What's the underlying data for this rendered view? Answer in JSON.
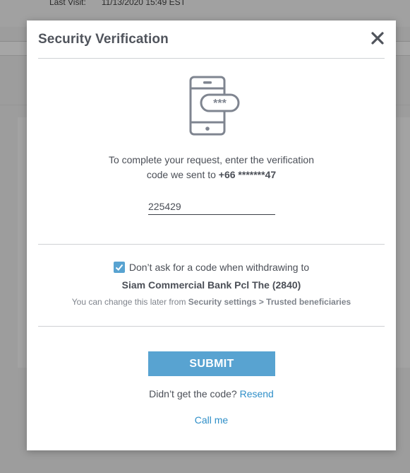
{
  "background": {
    "last_visit_label": "Last Visit:",
    "last_visit_value": "11/13/2020 15:49 EST"
  },
  "modal": {
    "title": "Security Verification",
    "close_icon": "close-icon",
    "phone_icon": "phone-password-icon",
    "phone_icon_text": "***",
    "instruction_line1": "To complete your request, enter the verification",
    "instruction_line2_prefix": "code we sent to",
    "phone_masked": "+66 *******47",
    "code_value": "225429",
    "remember": {
      "checked": true,
      "label": "Don’t ask for a code when withdrawing to",
      "bank": "Siam Commercial Bank Pcl The (2840)",
      "note_prefix": "You can change this later from",
      "note_link": "Security settings > Trusted beneficiaries"
    },
    "submit_label": "SUBMIT",
    "resend_prefix": "Didn’t get the code?",
    "resend_link": "Resend",
    "call_me": "Call me"
  },
  "colors": {
    "accent": "#58a3d1",
    "link": "#2f8fc8",
    "text": "#4b4f57",
    "overlay": "#9d9d9d"
  }
}
